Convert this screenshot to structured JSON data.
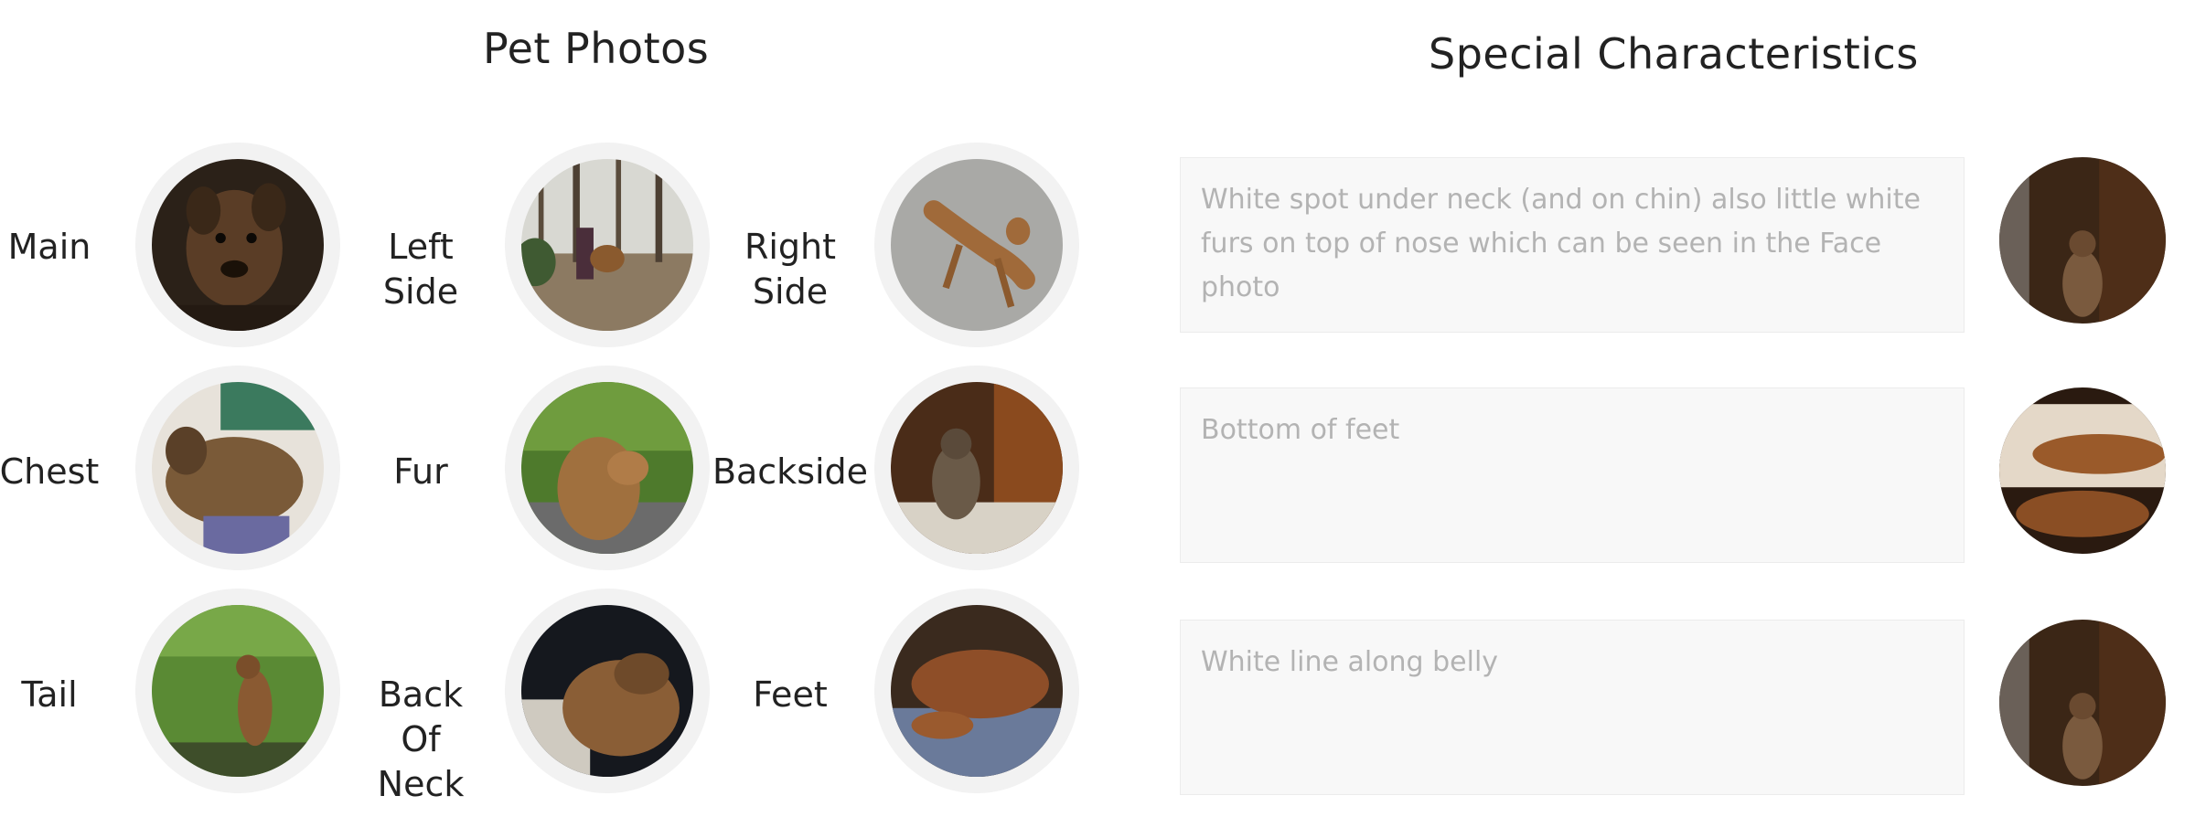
{
  "pet_photos": {
    "title": "Pet Photos",
    "items": [
      {
        "label": "Main"
      },
      {
        "label": "Left\nSide"
      },
      {
        "label": "Right\nSide"
      },
      {
        "label": "Chest"
      },
      {
        "label": "Fur"
      },
      {
        "label": "Backside"
      },
      {
        "label": "Tail"
      },
      {
        "label": "Back\nOf\nNeck"
      },
      {
        "label": "Feet"
      }
    ]
  },
  "special_characteristics": {
    "title": "Special Characteristics",
    "items": [
      {
        "text": "White spot under neck (and on chin) also little white furs on top of nose which can be seen in the Face photo"
      },
      {
        "text": "Bottom of feet"
      },
      {
        "text": "White line along belly"
      }
    ]
  }
}
